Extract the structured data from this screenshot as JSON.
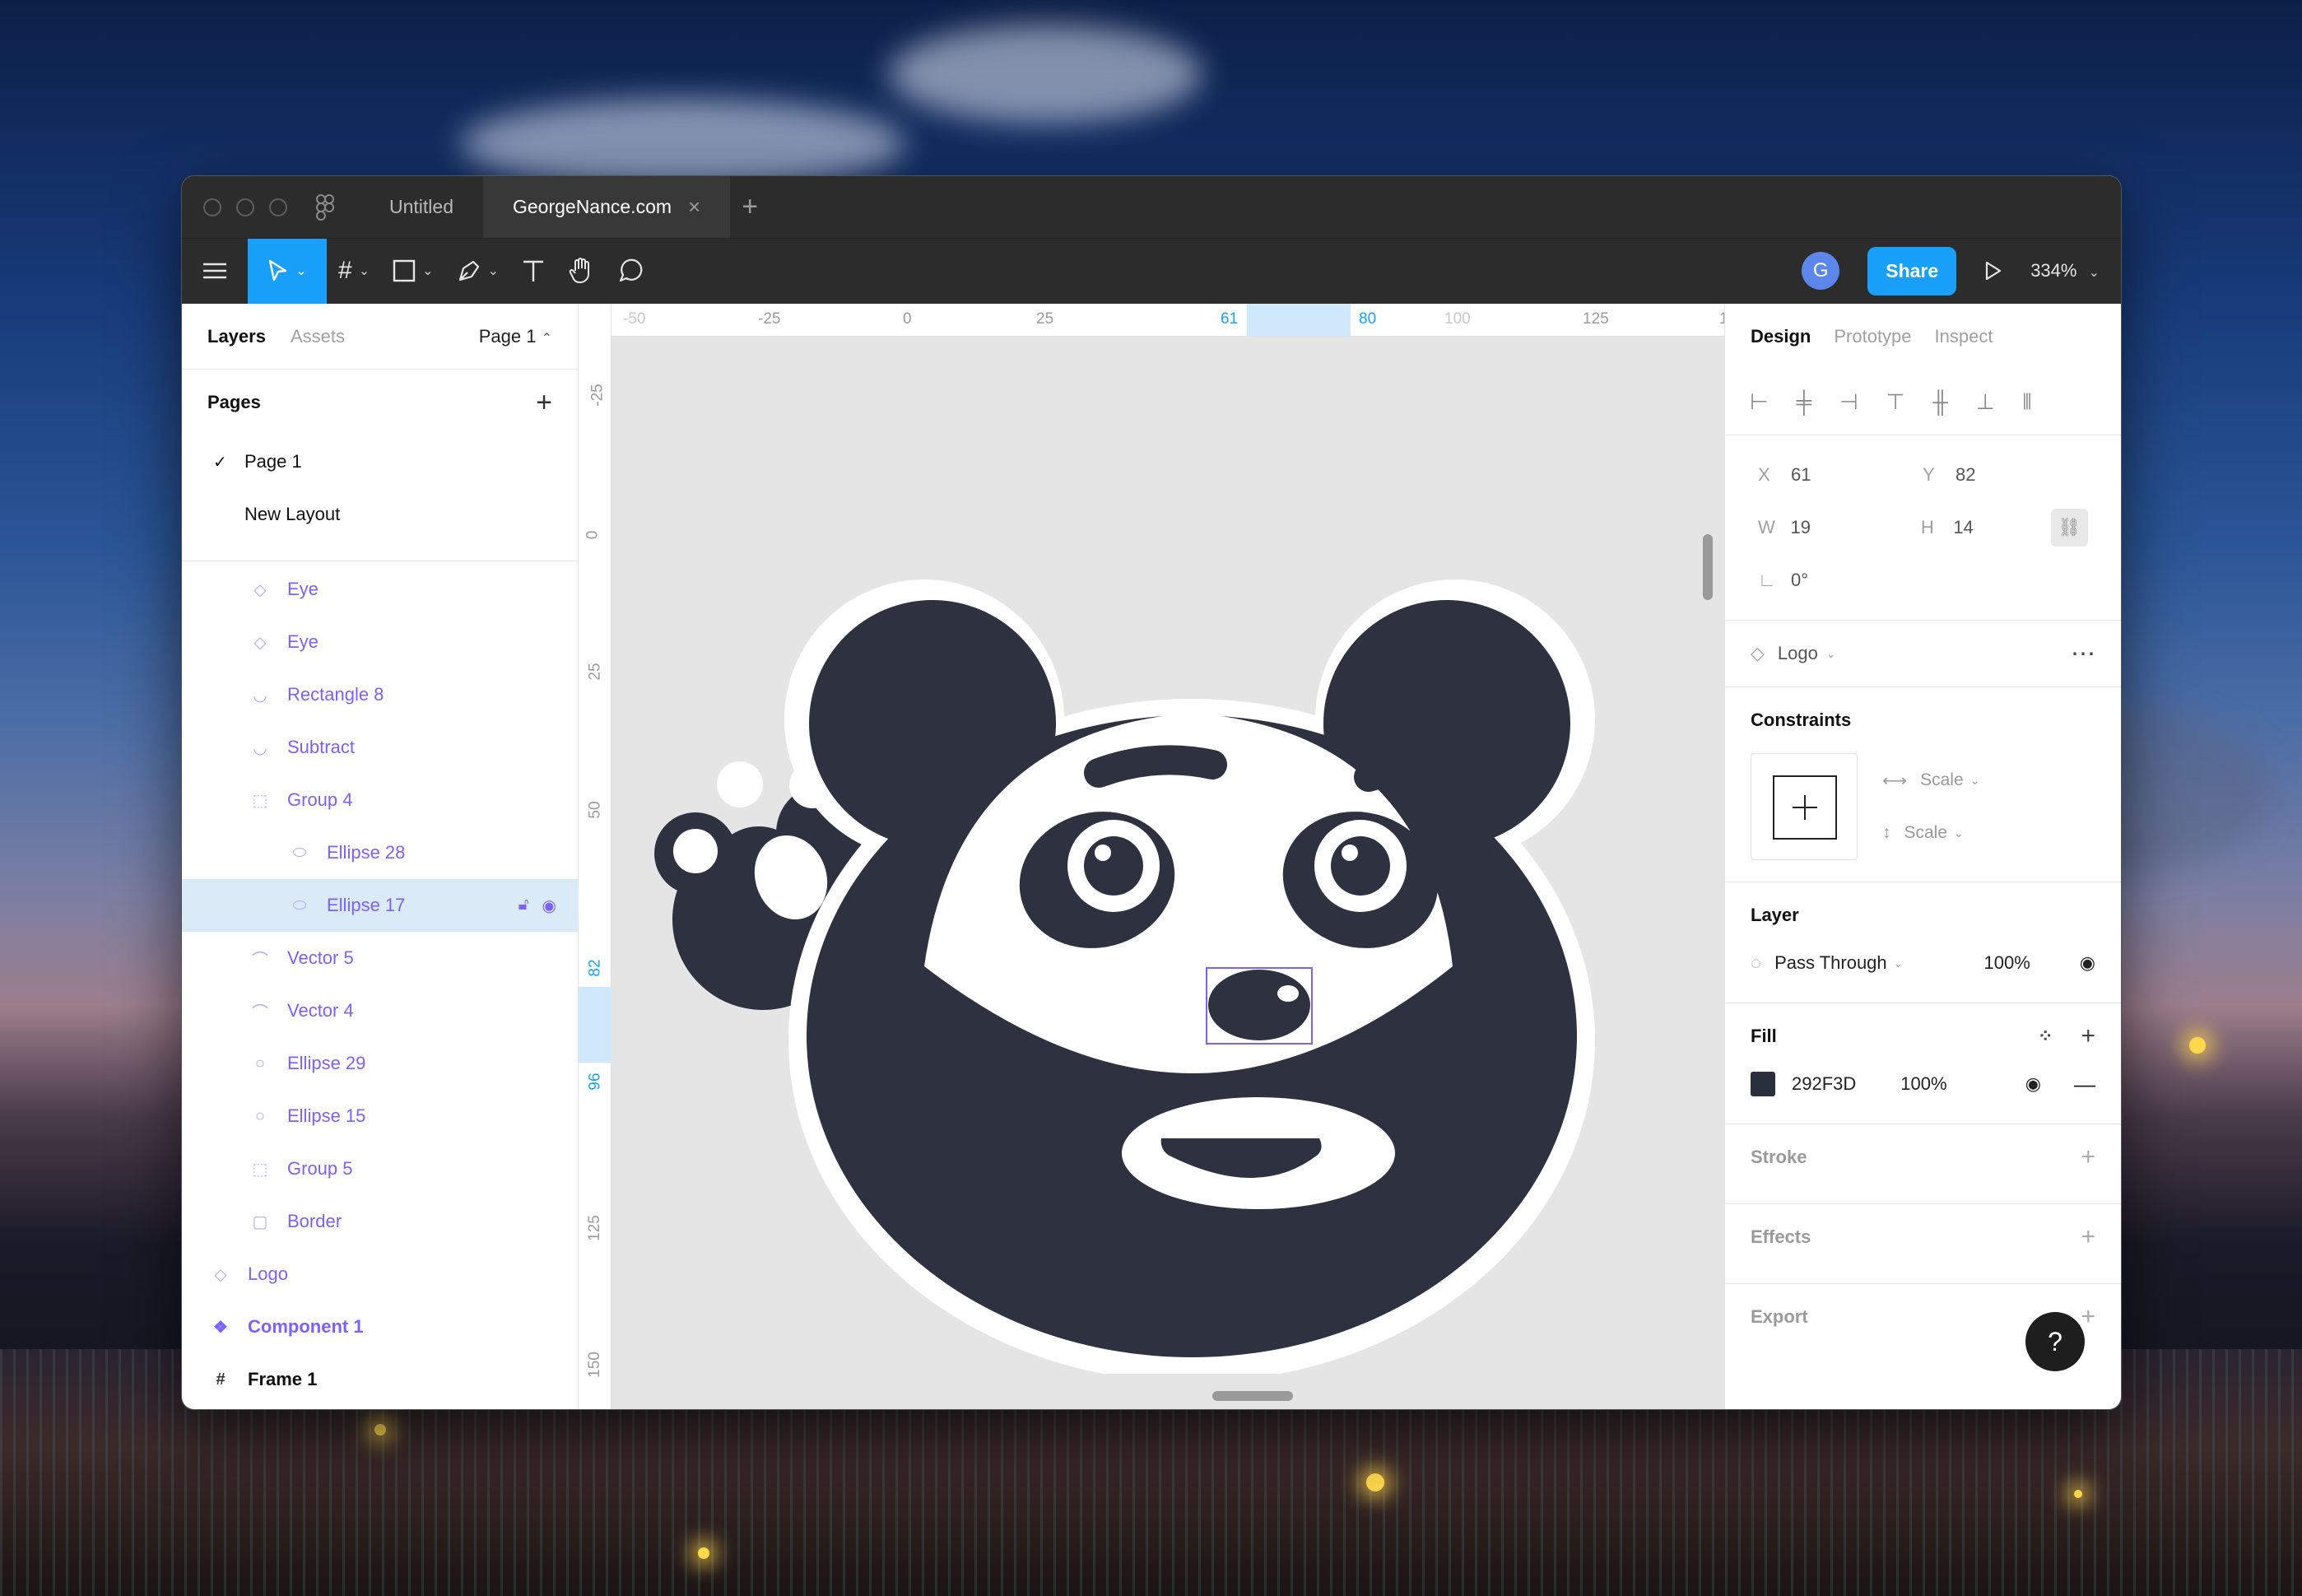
{
  "titlebar": {
    "tabs": [
      {
        "label": "Untitled",
        "active": false
      },
      {
        "label": "GeorgeNance.com",
        "active": true
      }
    ],
    "close_tab": "×",
    "add_tab": "+"
  },
  "toolbar": {
    "avatar": "G",
    "share_label": "Share",
    "zoom": "334%"
  },
  "left_panel": {
    "tabs": {
      "layers": "Layers",
      "assets": "Assets"
    },
    "page_selector": "Page 1",
    "pages_heading": "Pages",
    "pages": [
      "Page 1",
      "New Layout"
    ],
    "layers": [
      {
        "name": "Eye",
        "icon": "component-instance-icon",
        "indent": 1
      },
      {
        "name": "Eye",
        "icon": "component-instance-icon",
        "indent": 1
      },
      {
        "name": "Rectangle 8",
        "icon": "vector-icon",
        "indent": 1
      },
      {
        "name": "Subtract",
        "icon": "boolean-icon",
        "indent": 1
      },
      {
        "name": "Group 4",
        "icon": "group-icon",
        "indent": 1
      },
      {
        "name": "Ellipse 28",
        "icon": "ellipse-icon",
        "indent": 2
      },
      {
        "name": "Ellipse 17",
        "icon": "ellipse-icon",
        "indent": 2,
        "selected": true
      },
      {
        "name": "Vector 5",
        "icon": "vector-icon",
        "indent": 1
      },
      {
        "name": "Vector 4",
        "icon": "vector-icon",
        "indent": 1
      },
      {
        "name": "Ellipse 29",
        "icon": "ellipse-icon",
        "indent": 1
      },
      {
        "name": "Ellipse 15",
        "icon": "ellipse-icon",
        "indent": 1
      },
      {
        "name": "Group 5",
        "icon": "group-icon",
        "indent": 1
      },
      {
        "name": "Border",
        "icon": "rectangle-icon",
        "indent": 1
      },
      {
        "name": "Logo",
        "icon": "component-instance-icon",
        "indent": 0
      },
      {
        "name": "Component 1",
        "icon": "component-icon",
        "indent": 0
      },
      {
        "name": "Frame 1",
        "icon": "frame-icon",
        "indent": 0
      }
    ]
  },
  "rulers": {
    "h_ticks": [
      "-50",
      "-25",
      "0",
      "25",
      "61",
      "80",
      "100",
      "125",
      "1"
    ],
    "v_ticks": [
      "-25",
      "0",
      "25",
      "50",
      "82",
      "96",
      "125",
      "150"
    ]
  },
  "right_panel": {
    "tabs": {
      "design": "Design",
      "prototype": "Prototype",
      "inspect": "Inspect"
    },
    "x_label": "X",
    "x": "61",
    "y_label": "Y",
    "y": "82",
    "w_label": "W",
    "w": "19",
    "h_label": "H",
    "h": "14",
    "rotation": "0°",
    "component": "Logo",
    "constraints_heading": "Constraints",
    "constraint_h": "Scale",
    "constraint_v": "Scale",
    "layer_heading": "Layer",
    "blend_mode": "Pass Through",
    "layer_opacity": "100%",
    "fill_heading": "Fill",
    "fill_hex": "292F3D",
    "fill_opacity": "100%",
    "fill_color": "#292F3D",
    "stroke_heading": "Stroke",
    "effects_heading": "Effects",
    "export_heading": "Export",
    "help": "?"
  },
  "colors": {
    "accent": "#18A0FB",
    "component_purple": "#7B61FF",
    "panda_dark": "#2D3140"
  }
}
